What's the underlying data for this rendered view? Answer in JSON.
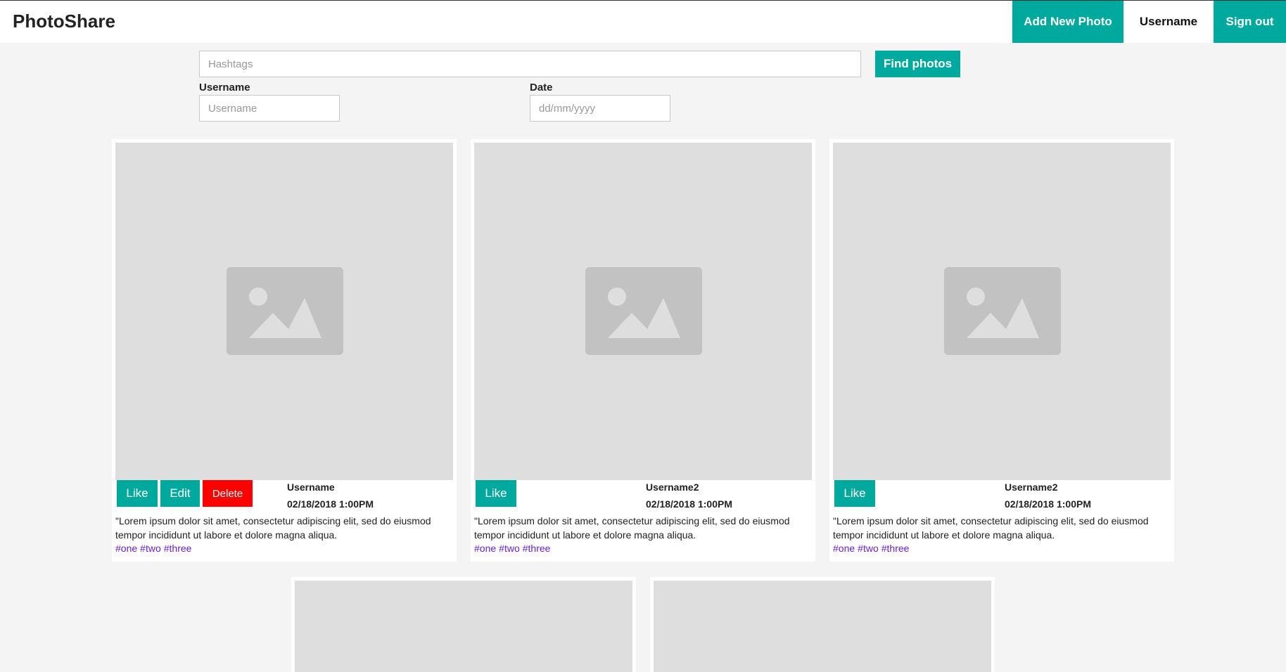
{
  "app": {
    "brand": "PhotoShare",
    "nav": {
      "add_photo": "Add New Photo",
      "username": "Username",
      "sign_out": "Sign out"
    }
  },
  "search": {
    "hashtags_placeholder": "Hashtags",
    "find_button": "Find photos",
    "username_label": "Username",
    "username_placeholder": "Username",
    "date_label": "Date",
    "date_placeholder": "dd/mm/yyyy"
  },
  "colors": {
    "accent": "#00a99d",
    "danger": "#ff0000",
    "hashtag": "#6a1fd0",
    "placeholder_bg": "#dedede"
  },
  "posts": [
    {
      "image_icon": "image-placeholder-icon",
      "like": "Like",
      "edit": "Edit",
      "delete": "Delete",
      "username": "Username",
      "date": "02/18/2018 1:00PM",
      "caption": "\"Lorem ipsum dolor sit amet, consectetur adipiscing elit, sed do eiusmod tempor incididunt ut labore et dolore magna aliqua.",
      "tags": [
        "#one",
        "#two",
        "#three"
      ]
    },
    {
      "image_icon": "image-placeholder-icon",
      "like": "Like",
      "username": "Username2",
      "date": "02/18/2018 1:00PM",
      "caption": "\"Lorem ipsum dolor sit amet, consectetur adipiscing elit, sed do eiusmod tempor incididunt ut labore et dolore magna aliqua.",
      "tags": [
        "#one",
        "#two",
        "#three"
      ]
    },
    {
      "image_icon": "image-placeholder-icon",
      "like": "Like",
      "username": "Username2",
      "date": "02/18/2018 1:00PM",
      "caption": "\"Lorem ipsum dolor sit amet, consectetur adipiscing elit, sed do eiusmod tempor incididunt ut labore et dolore magna aliqua.",
      "tags": [
        "#one",
        "#two",
        "#three"
      ]
    }
  ]
}
